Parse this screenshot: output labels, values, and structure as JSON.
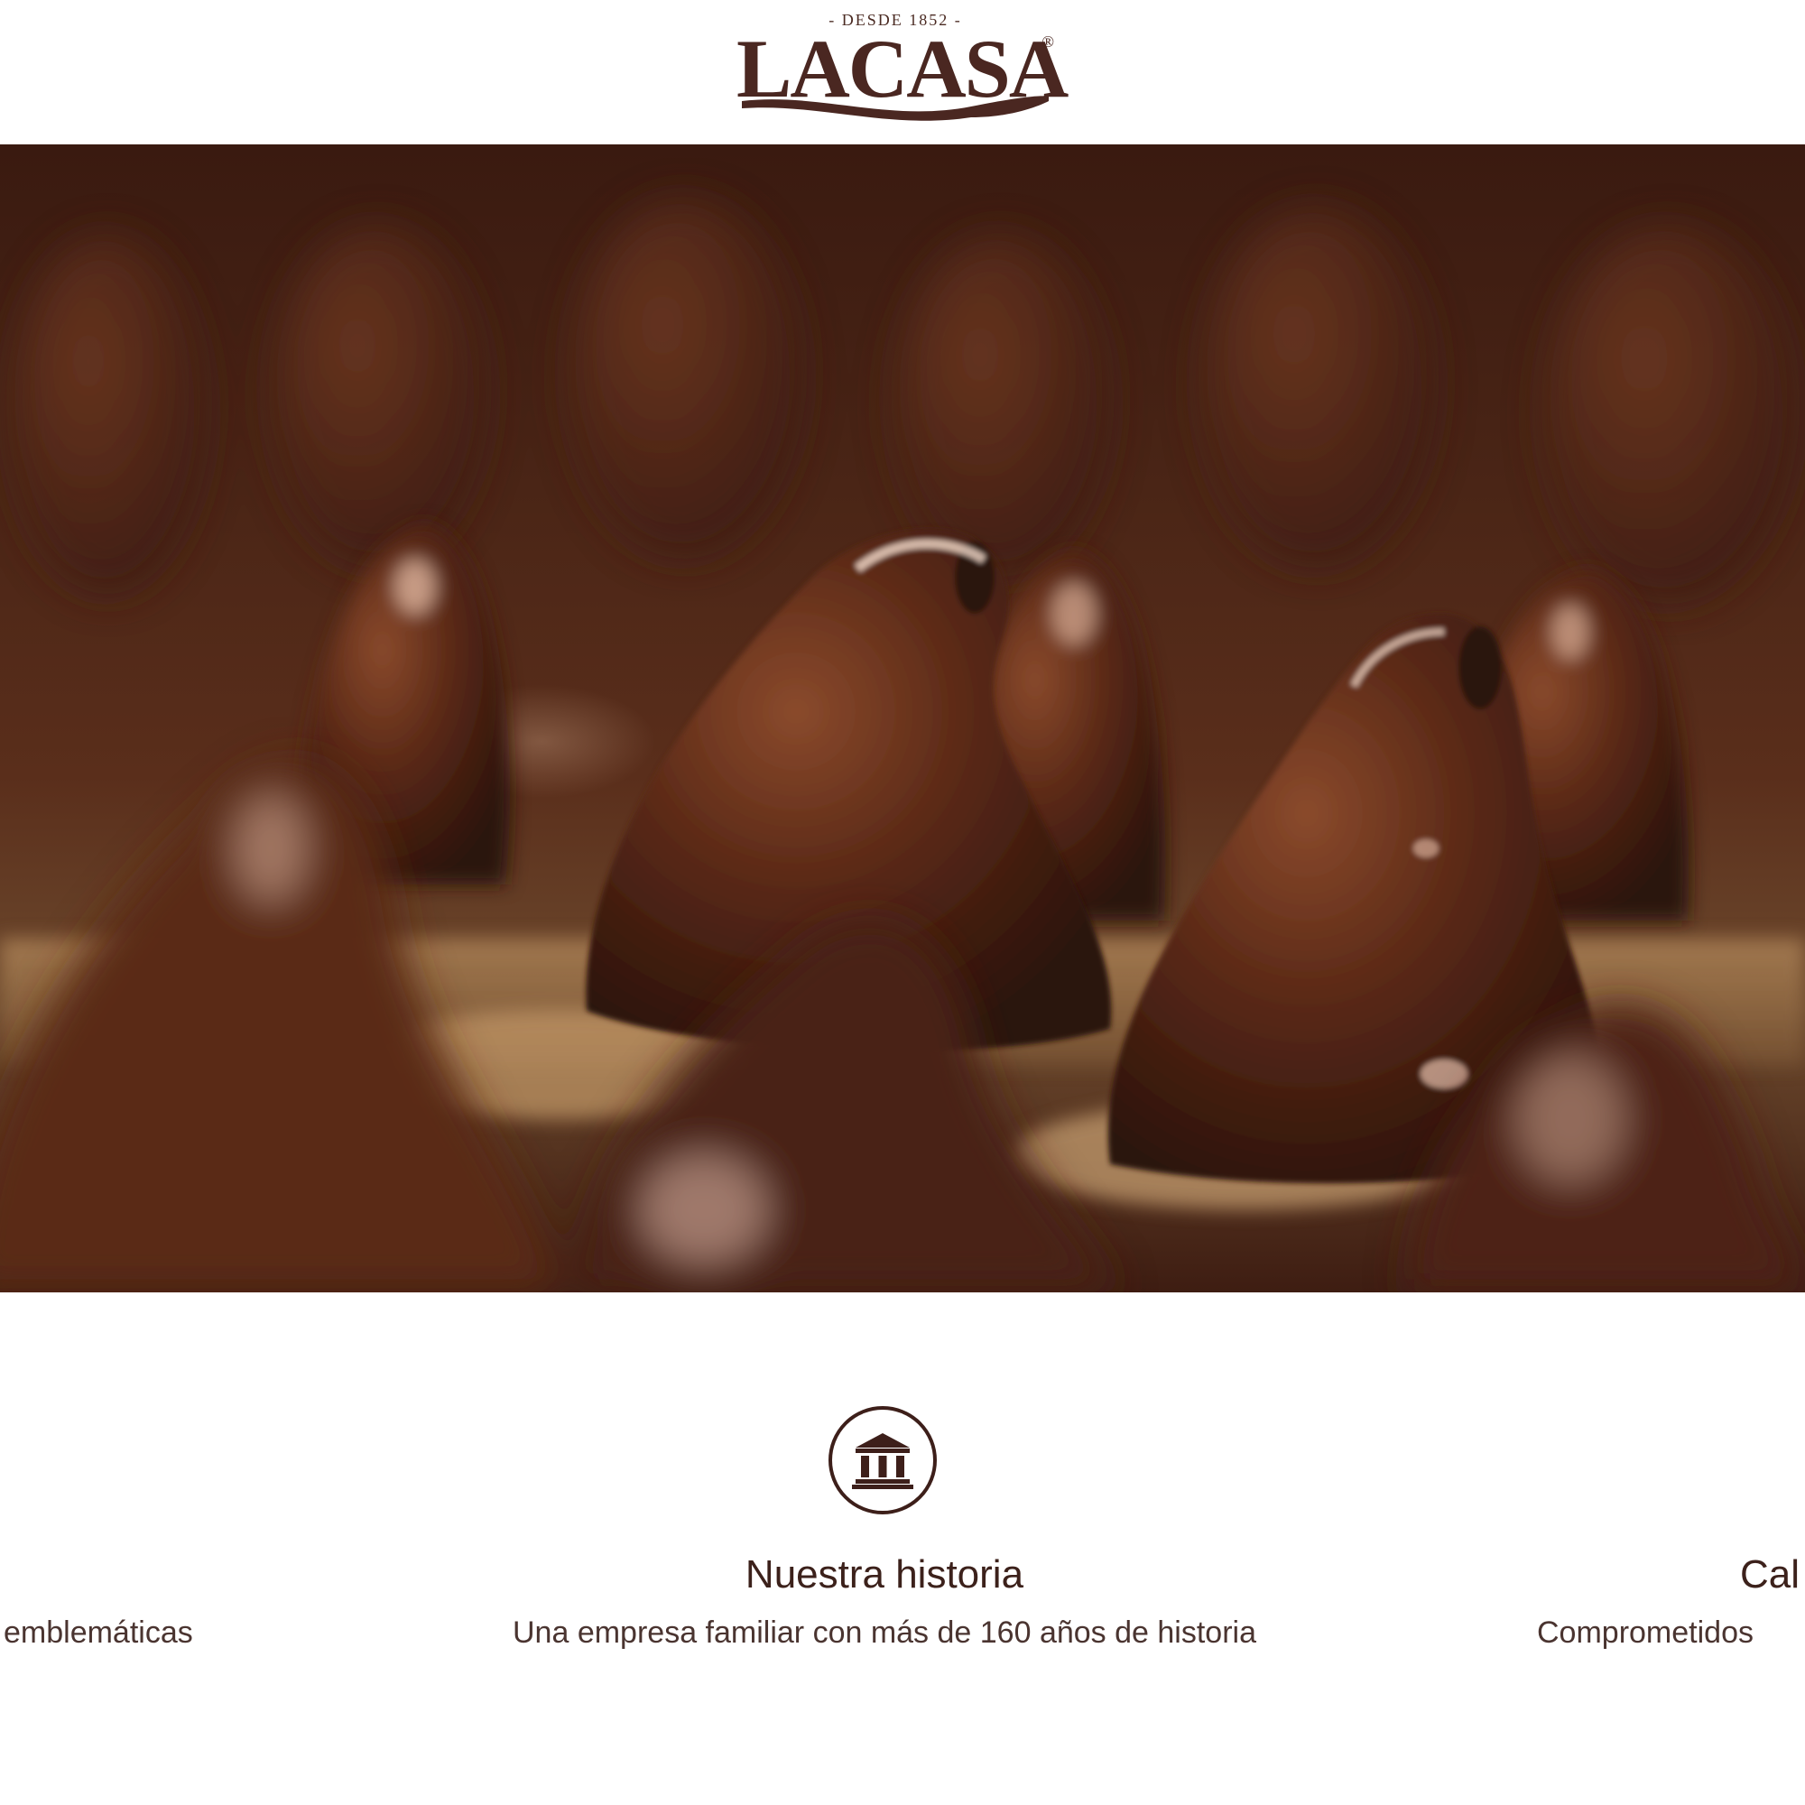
{
  "header": {
    "logo": {
      "tagline": "- DESDE 1852 -",
      "wordmark": "LACASA",
      "registered": "®"
    }
  },
  "hero": {
    "image_subject": "chocolate-coated sweets on a production line"
  },
  "features": {
    "left": {
      "description_fragment": "emblemáticas"
    },
    "center": {
      "icon": "museum-icon",
      "title": "Nuestra historia",
      "description": "Una empresa familiar con más de 160 años de historia"
    },
    "right": {
      "title_fragment": "Cal",
      "description_fragment": "Comprometidos"
    }
  },
  "colors": {
    "brand_brown": "#4a2721",
    "text_dark": "#3c211b",
    "background": "#ffffff"
  }
}
